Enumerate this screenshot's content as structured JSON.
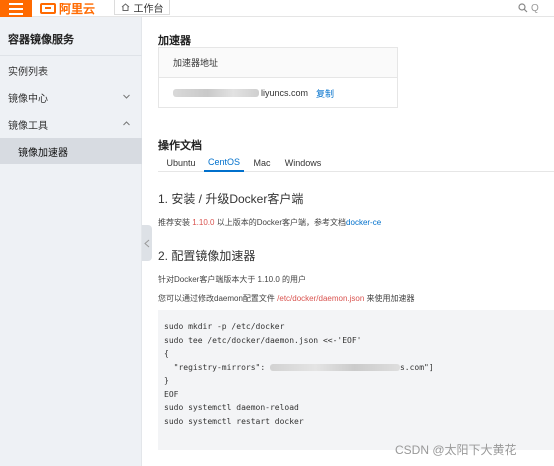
{
  "topbar": {
    "logo_text": "阿里云",
    "workbench_label": "工作台",
    "search_label": "Q"
  },
  "sidebar": {
    "title": "容器镜像服务",
    "items": [
      {
        "label": "实例列表"
      },
      {
        "label": "镜像中心",
        "chevron": "down"
      },
      {
        "label": "镜像工具",
        "chevron": "up"
      },
      {
        "label": "镜像加速器",
        "active": true
      }
    ]
  },
  "accelerator": {
    "section_title": "加速器",
    "table_header": "加速器地址",
    "address_suffix": "liyuncs.com",
    "copy_label": "复制"
  },
  "docs": {
    "section_title": "操作文档",
    "tabs": [
      "Ubuntu",
      "CentOS",
      "Mac",
      "Windows"
    ],
    "active_tab": "CentOS",
    "step1_title": "1. 安装 / 升级Docker客户端",
    "step1_text_a": "推荐安装 ",
    "step1_version": "1.10.0",
    "step1_text_b": " 以上版本的Docker客户端，参考文档",
    "step1_link": "docker-ce",
    "step2_title": "2. 配置镜像加速器",
    "step2_text1": "针对Docker客户端版本大于 1.10.0 的用户",
    "step2_text2_a": "您可以通过修改daemon配置文件 ",
    "step2_text2_path": "/etc/docker/daemon.json",
    "step2_text2_b": " 来使用加速器",
    "code": {
      "line1": "sudo mkdir -p /etc/docker",
      "line2": "sudo tee /etc/docker/daemon.json <<-'EOF'",
      "line3": "{",
      "line4_a": "  \"registry-mirrors\": ",
      "line4_b": "s.com\"]",
      "line5": "}",
      "line6": "EOF",
      "line7": "sudo systemctl daemon-reload",
      "line8": "sudo systemctl restart docker"
    }
  },
  "watermark": "CSDN @太阳下大黄花",
  "colors": {
    "brand_orange": "#ff6a00",
    "link_blue": "#0070cc",
    "highlight_red": "#d9534f",
    "sidebar_bg": "#eef1f5"
  }
}
